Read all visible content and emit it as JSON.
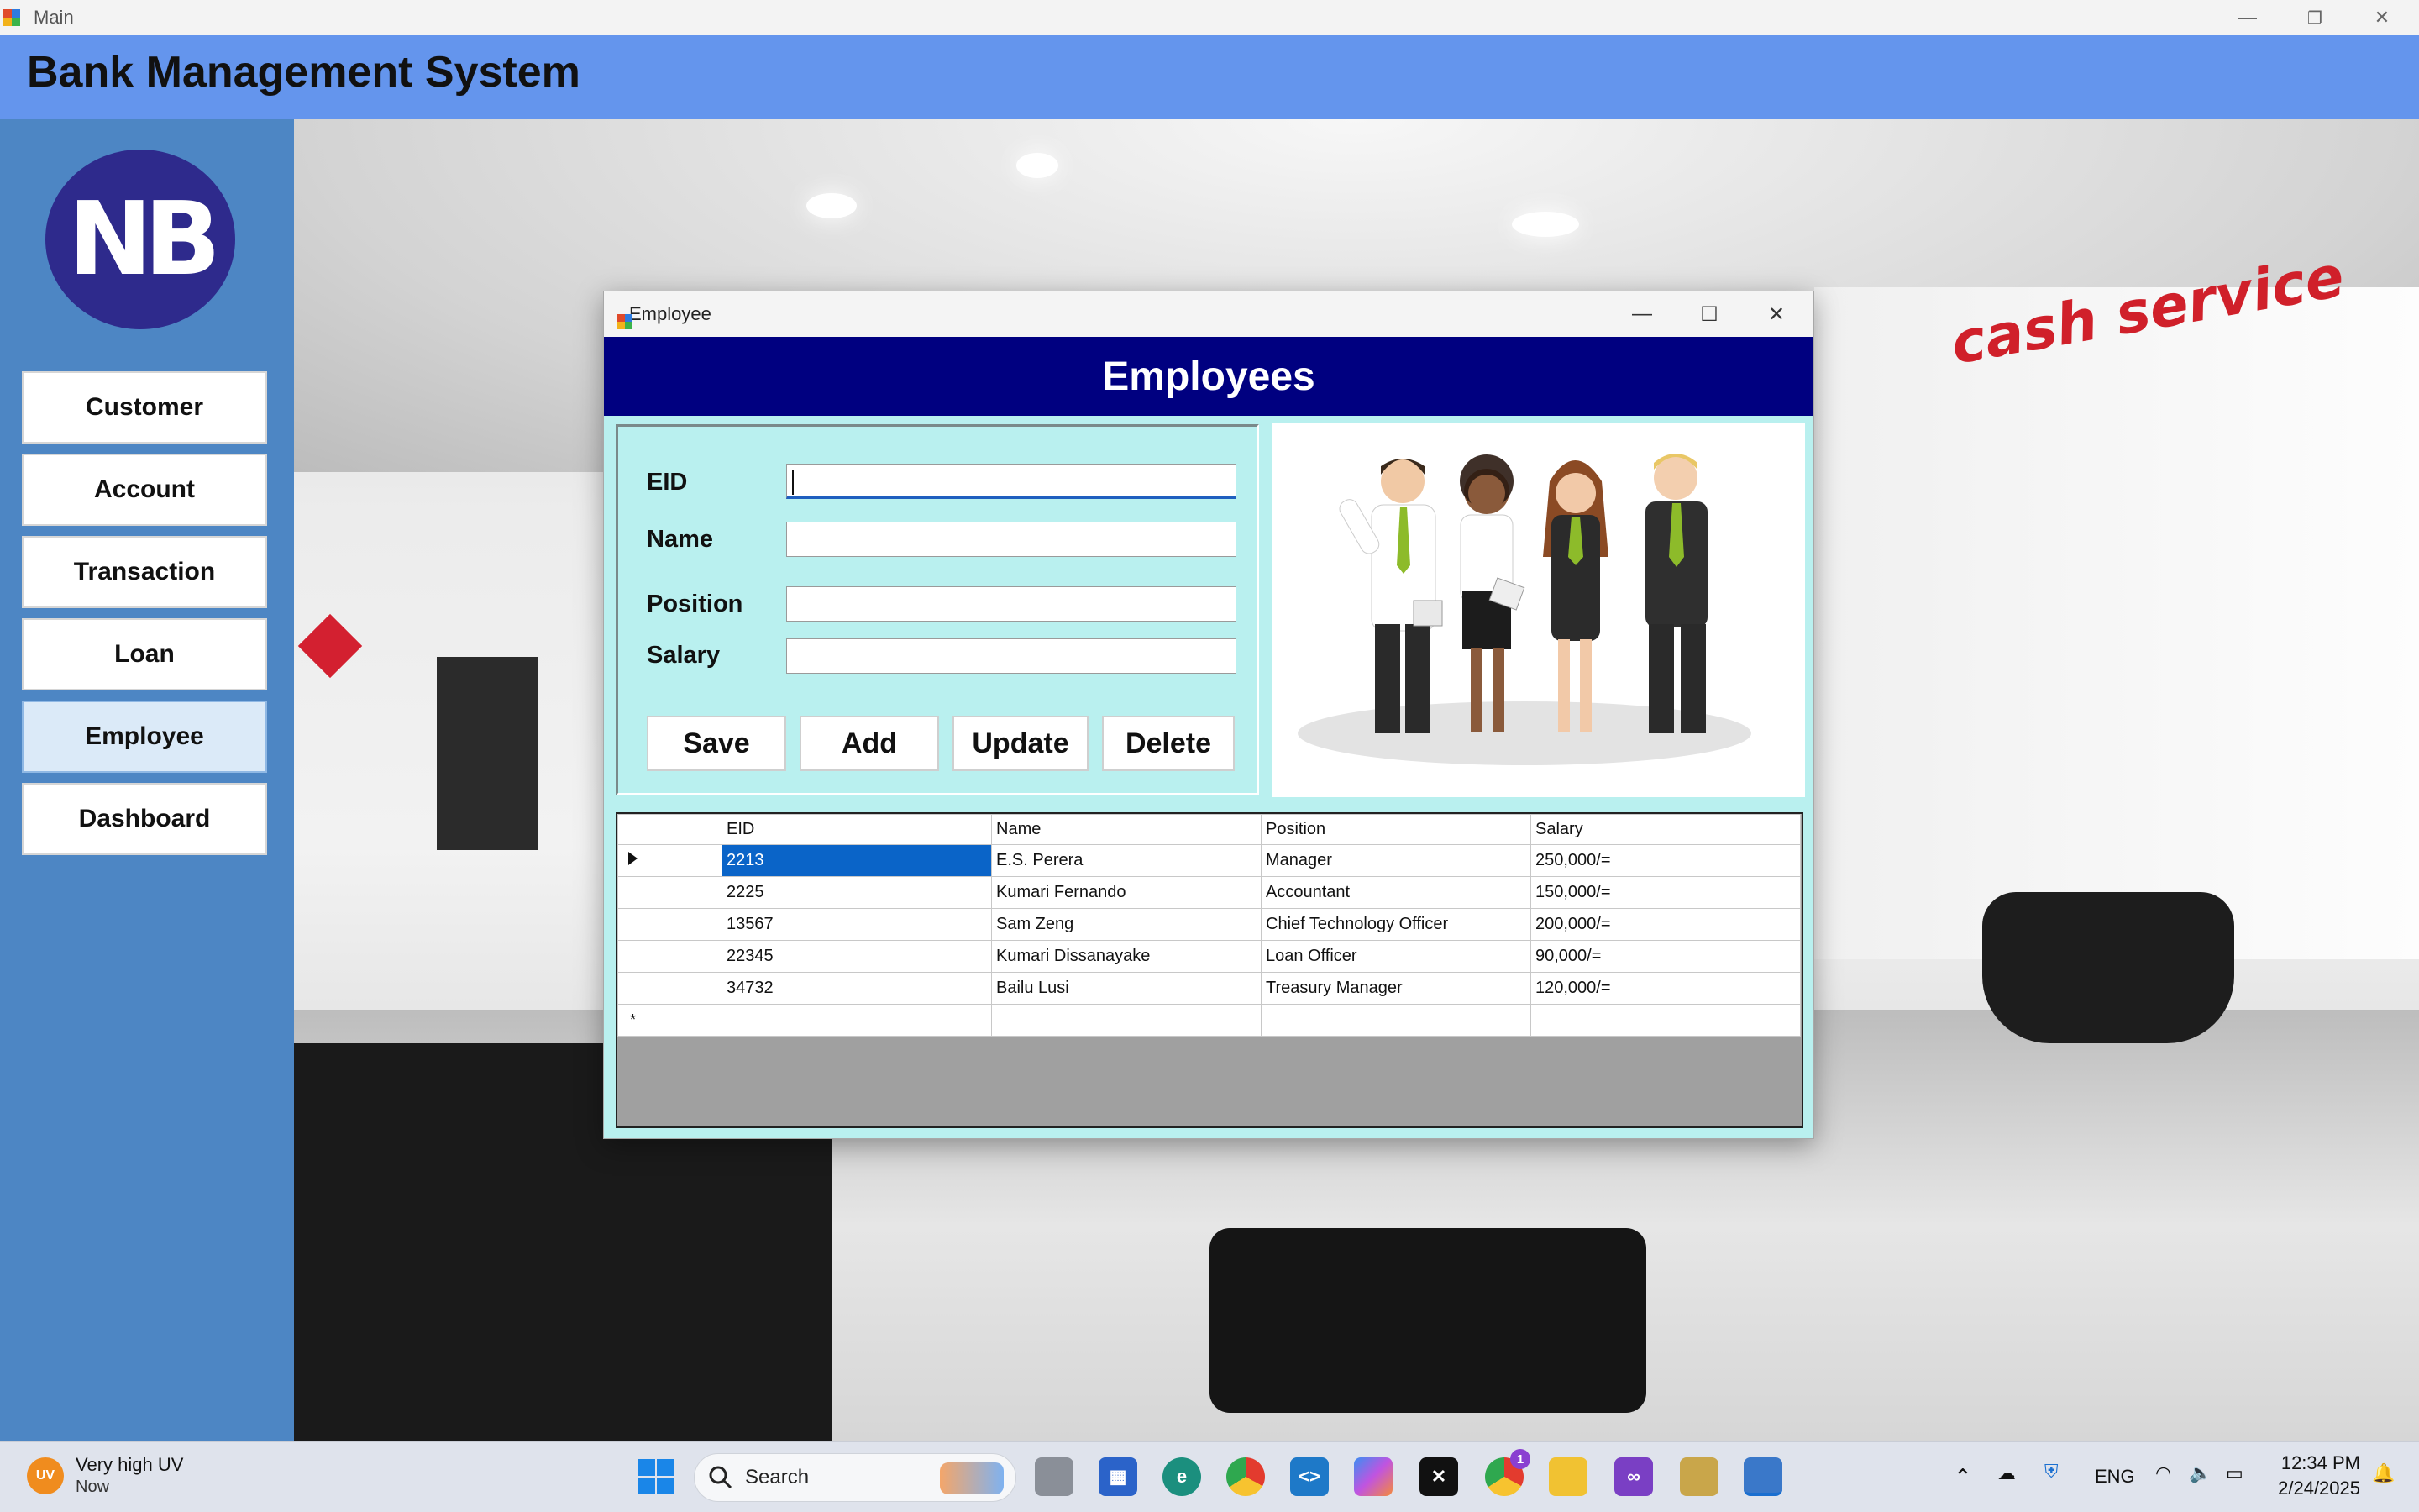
{
  "window": {
    "title": "Main",
    "minimize": "—",
    "restore": "❐",
    "close": "✕"
  },
  "header": {
    "title": "Bank Management System"
  },
  "sidebar": {
    "logo_text": "NB",
    "items": [
      {
        "label": "Customer"
      },
      {
        "label": "Account"
      },
      {
        "label": "Transaction"
      },
      {
        "label": "Loan"
      },
      {
        "label": "Employee"
      },
      {
        "label": "Dashboard"
      }
    ]
  },
  "background": {
    "sign_text": "cash service"
  },
  "dialog": {
    "title": "Employee",
    "minimize": "—",
    "maximize": "☐",
    "close": "✕",
    "banner": "Employees",
    "form": {
      "eid_label": "EID",
      "name_label": "Name",
      "position_label": "Position",
      "salary_label": "Salary",
      "eid_value": "",
      "name_value": "",
      "position_value": "",
      "salary_value": ""
    },
    "buttons": {
      "save": "Save",
      "add": "Add",
      "update": "Update",
      "delete": "Delete"
    },
    "grid": {
      "columns": [
        "EID",
        "Name",
        "Position",
        "Salary"
      ],
      "rows": [
        [
          "2213",
          "E.S. Perera",
          "Manager",
          "250,000/="
        ],
        [
          "2225",
          "Kumari Fernando",
          "Accountant",
          "150,000/="
        ],
        [
          "13567",
          "Sam Zeng",
          "Chief Technology Officer",
          "200,000/="
        ],
        [
          "22345",
          "Kumari Dissanayake",
          "Loan Officer",
          "90,000/="
        ],
        [
          "34732",
          "Bailu Lusi",
          "Treasury Manager",
          "120,000/="
        ]
      ],
      "new_row_marker": "*"
    }
  },
  "taskbar": {
    "weather_badge": "UV",
    "weather_title": "Very high UV",
    "weather_sub": "Now",
    "search_label": "Search",
    "language": "ENG",
    "time": "12:34 PM",
    "date": "2/24/2025",
    "notification_count": "1"
  },
  "colors": {
    "header": "#6495ed",
    "sidebar": "#4d86c4",
    "dialog_banner": "#000080",
    "dialog_body": "#b9f0ef",
    "grid_selection": "#0a64c8"
  }
}
